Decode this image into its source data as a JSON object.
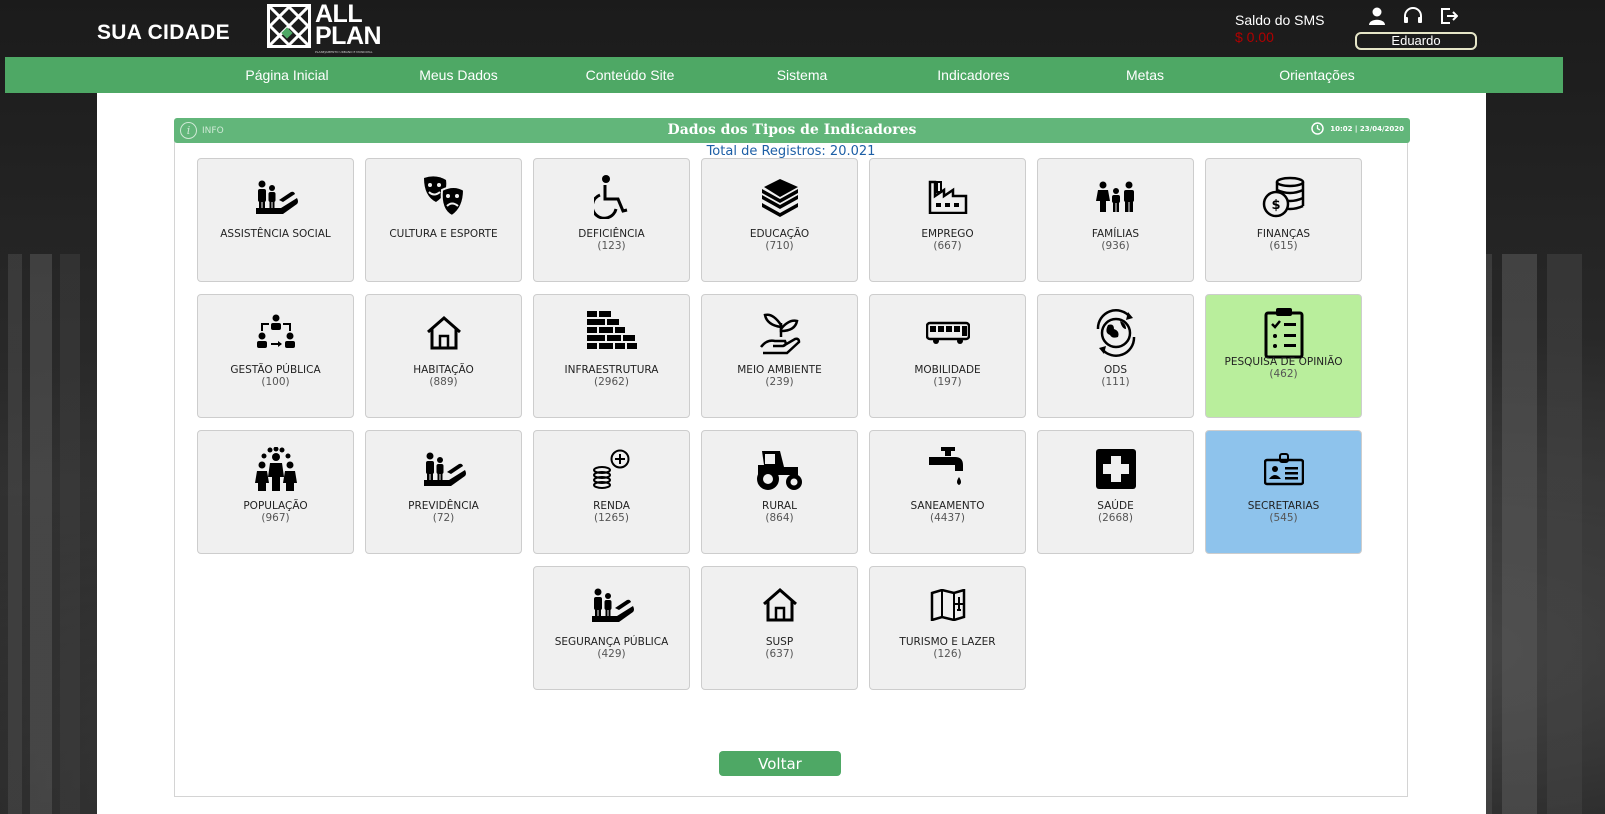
{
  "header": {
    "city": "SUA CIDADE",
    "logo_line1": "ALL",
    "logo_line2": "PLAN",
    "logo_tagline": "PLANEJAMENTO URBANO E MUNICIPAL",
    "sms_label": "Saldo do SMS",
    "sms_value": "$ 0.00",
    "user_name": "Eduardo",
    "icons": [
      "user-icon",
      "headset-icon",
      "logout-icon"
    ]
  },
  "nav": [
    "Página Inicial",
    "Meus Dados",
    "Conteúdo Site",
    "Sistema",
    "Indicadores",
    "Metas",
    "Orientações"
  ],
  "panel": {
    "info_label": "INFO",
    "title": "Dados dos Tipos de Indicadores",
    "datetime": "10:02 | 23/04/2020",
    "total": "Total de Registros: 20.021",
    "back_label": "Voltar"
  },
  "tiles": [
    {
      "name": "ASSISTÊNCIA SOCIAL",
      "count": "",
      "icon": "hand-people-icon"
    },
    {
      "name": "CULTURA E ESPORTE",
      "count": "",
      "icon": "theater-masks-icon"
    },
    {
      "name": "DEFICIÊNCIA",
      "count": "(123)",
      "icon": "wheelchair-icon"
    },
    {
      "name": "EDUCAÇÃO",
      "count": "(710)",
      "icon": "books-icon"
    },
    {
      "name": "EMPREGO",
      "count": "(667)",
      "icon": "factory-icon"
    },
    {
      "name": "FAMÍLIAS",
      "count": "(936)",
      "icon": "family-icon"
    },
    {
      "name": "FINANÇAS",
      "count": "(615)",
      "icon": "coins-icon"
    },
    {
      "name": "GESTÃO PÚBLICA",
      "count": "(100)",
      "icon": "management-icon"
    },
    {
      "name": "HABITAÇÃO",
      "count": "(889)",
      "icon": "house-icon"
    },
    {
      "name": "INFRAESTRUTURA",
      "count": "(2962)",
      "icon": "bricks-icon"
    },
    {
      "name": "MEIO AMBIENTE",
      "count": "(239)",
      "icon": "plant-hand-icon"
    },
    {
      "name": "MOBILIDADE",
      "count": "(197)",
      "icon": "bus-icon"
    },
    {
      "name": "ODS",
      "count": "(111)",
      "icon": "globe-cycle-icon"
    },
    {
      "name": "PESQUISA DE OPINIÃO",
      "count": "(462)",
      "icon": "clipboard-checklist-icon",
      "highlight": "#b9ee9c"
    },
    {
      "name": "POPULAÇÃO",
      "count": "(967)",
      "icon": "crowd-icon"
    },
    {
      "name": "PREVIDÊNCIA",
      "count": "(72)",
      "icon": "hand-people-icon"
    },
    {
      "name": "RENDA",
      "count": "(1265)",
      "icon": "coins-plus-icon"
    },
    {
      "name": "RURAL",
      "count": "(864)",
      "icon": "tractor-icon"
    },
    {
      "name": "SANEAMENTO",
      "count": "(4437)",
      "icon": "faucet-icon"
    },
    {
      "name": "SAÚDE",
      "count": "(2668)",
      "icon": "medical-cross-icon"
    },
    {
      "name": "SECRETARIAS",
      "count": "(545)",
      "icon": "id-badge-icon",
      "highlight": "#8ec3ec"
    },
    {
      "name": "SEGURANÇA PÚBLICA",
      "count": "(429)",
      "icon": "hand-people-icon"
    },
    {
      "name": "SUSP",
      "count": "(637)",
      "icon": "house-icon"
    },
    {
      "name": "TURISMO E LAZER",
      "count": "(126)",
      "icon": "map-plane-icon"
    }
  ],
  "colors": {
    "nav_green": "#4ea865",
    "header_green": "#62b67a",
    "highlight_green": "#b9ee9c",
    "highlight_blue": "#8ec3ec",
    "total_blue": "#1d5fa6",
    "sms_red": "#b00000"
  }
}
